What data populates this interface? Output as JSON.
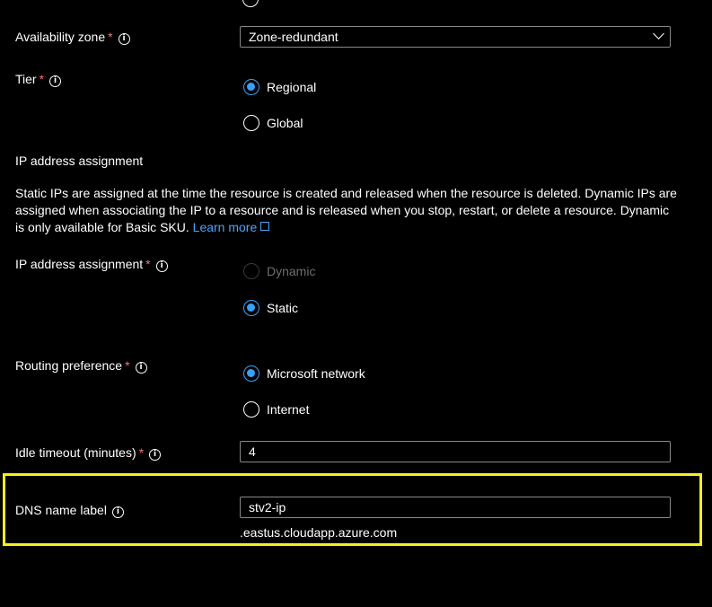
{
  "availability_zone": {
    "label": "Availability zone",
    "required": "*",
    "info_icon": "i",
    "value": "Zone-redundant"
  },
  "tier": {
    "label": "Tier",
    "required": "*",
    "info_icon": "i",
    "options": [
      {
        "label": "Regional",
        "selected": true
      },
      {
        "label": "Global",
        "selected": false
      }
    ]
  },
  "ip_section": {
    "heading": "IP address assignment",
    "description": "Static IPs are assigned at the time the resource is created and released when the resource is deleted. Dynamic IPs are assigned when associating the IP to a resource and is released when you stop, restart, or delete a resource. Dynamic is only available for Basic SKU.",
    "learn_more": "Learn more"
  },
  "ip_assignment": {
    "label": "IP address assignment",
    "required": "*",
    "info_icon": "i",
    "options": [
      {
        "label": "Dynamic",
        "selected": false,
        "disabled": true
      },
      {
        "label": "Static",
        "selected": true
      }
    ]
  },
  "routing": {
    "label": "Routing preference",
    "required": "*",
    "info_icon": "i",
    "options": [
      {
        "label": "Microsoft network",
        "selected": true
      },
      {
        "label": "Internet",
        "selected": false
      }
    ]
  },
  "idle_timeout": {
    "label": "Idle timeout (minutes)",
    "required": "*",
    "info_icon": "i",
    "value": "4"
  },
  "dns": {
    "label": "DNS name label",
    "info_icon": "i",
    "value": "stv2-ip",
    "suffix": ".eastus.cloudapp.azure.com"
  },
  "colors": {
    "accent": "#3aa0f3",
    "required": "#f1707b",
    "highlight": "#f7f01c",
    "link": "#4fa3f7"
  }
}
